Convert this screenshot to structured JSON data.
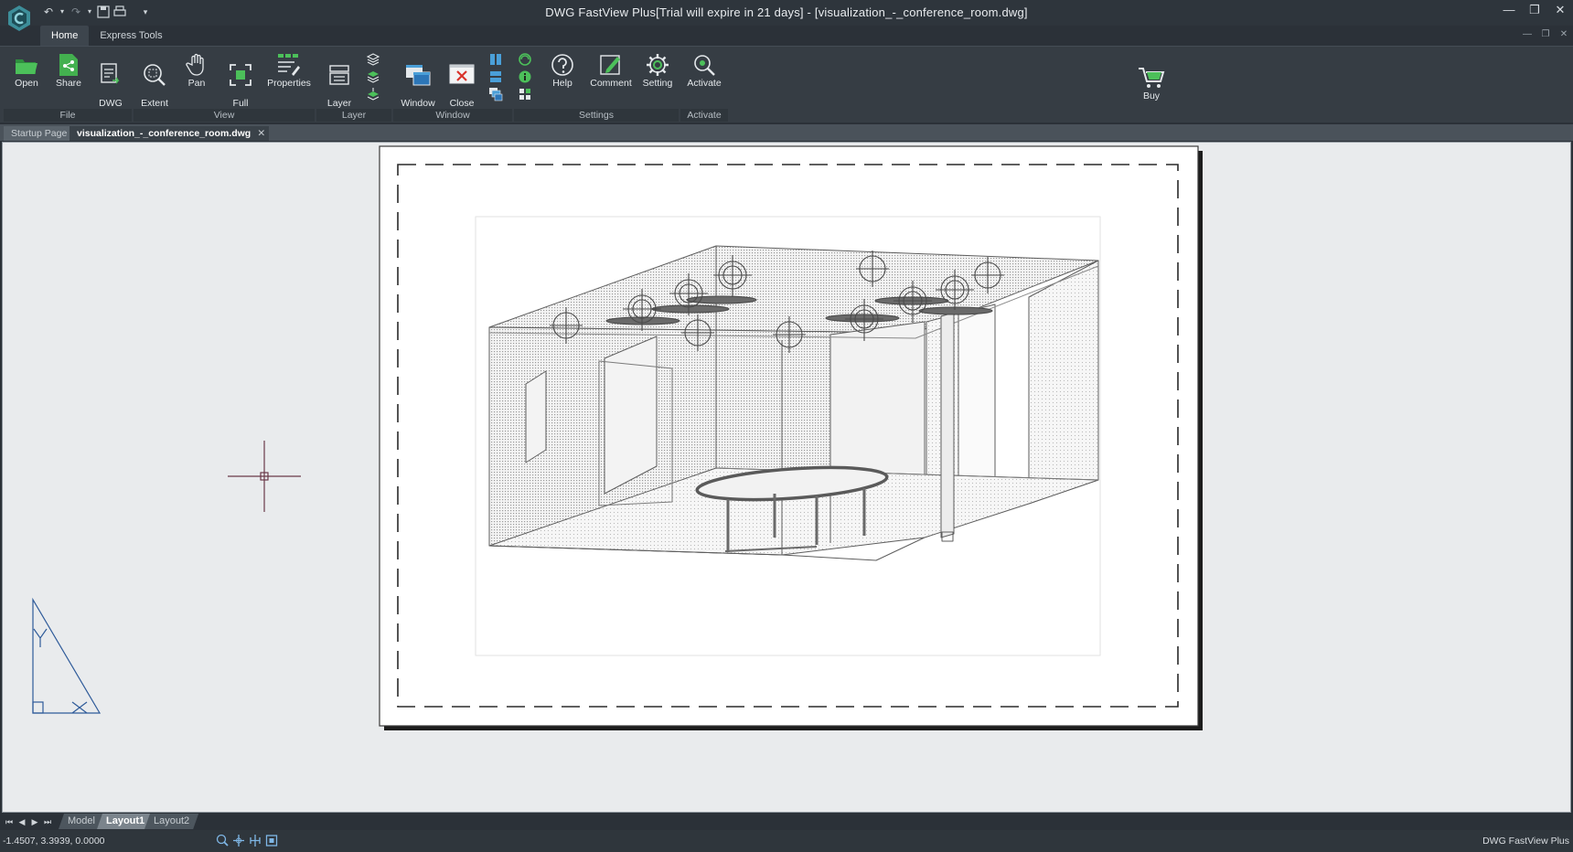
{
  "window": {
    "title": "DWG FastView Plus[Trial will expire in 21 days] - [visualization_-_conference_room.dwg]",
    "minimize": "—",
    "restore": "❐",
    "close": "✕"
  },
  "quick_access": [
    "undo",
    "redo",
    "save",
    "print",
    "customize"
  ],
  "ribbon_tabs": [
    {
      "label": "Home",
      "active": true
    },
    {
      "label": "Express Tools",
      "active": false
    }
  ],
  "ribbon": {
    "groups": [
      {
        "label": "File",
        "buttons": [
          {
            "label": "Open",
            "icon": "folder-open-icon"
          },
          {
            "label": "Share",
            "icon": "share-icon"
          },
          {
            "label": "DWG\nConvert",
            "icon": "dwg-convert-icon"
          }
        ]
      },
      {
        "label": "View",
        "buttons": [
          {
            "label": "Extent\n⌄",
            "icon": "zoom-extent-icon"
          },
          {
            "label": "Pan",
            "icon": "pan-hand-icon"
          },
          {
            "label": "Full\nScreen",
            "icon": "full-screen-icon"
          },
          {
            "label": "Properties",
            "icon": "properties-icon"
          }
        ]
      },
      {
        "label": "Layer",
        "buttons": [
          {
            "label": "Layer\nToolbar",
            "icon": "layer-toolbar-icon"
          }
        ]
      },
      {
        "label": "Window",
        "buttons": [
          {
            "label": "Window\nActive",
            "icon": "window-active-icon"
          },
          {
            "label": "Close\nAll",
            "icon": "close-all-icon"
          }
        ]
      },
      {
        "label": "Settings",
        "buttons": [
          {
            "label": "Help",
            "icon": "help-icon"
          },
          {
            "label": "Comment",
            "icon": "comment-icon"
          },
          {
            "label": "Setting",
            "icon": "gear-icon"
          }
        ]
      },
      {
        "label": "Activate",
        "buttons": [
          {
            "label": "Activate",
            "icon": "activate-search-icon"
          }
        ]
      }
    ],
    "buy": {
      "label": "Buy",
      "icon": "shopping-cart-icon"
    }
  },
  "doc_tabs": [
    {
      "label": "Startup Page",
      "active": false
    },
    {
      "label": "visualization_-_conference_room.dwg",
      "active": true
    }
  ],
  "layout_tabs": [
    {
      "label": "Model",
      "active": false
    },
    {
      "label": "Layout1",
      "active": true
    },
    {
      "label": "Layout2",
      "active": false
    }
  ],
  "status": {
    "coordinates": "-1.4507, 3.3939, 0.0000",
    "brand": "DWG FastView Plus"
  },
  "colors": {
    "accent_green": "#3fae49",
    "chrome_dark": "#2e353c",
    "ribbon": "#363d44",
    "canvas": "#e9ebed",
    "crosshair": "#6b3a4a"
  }
}
